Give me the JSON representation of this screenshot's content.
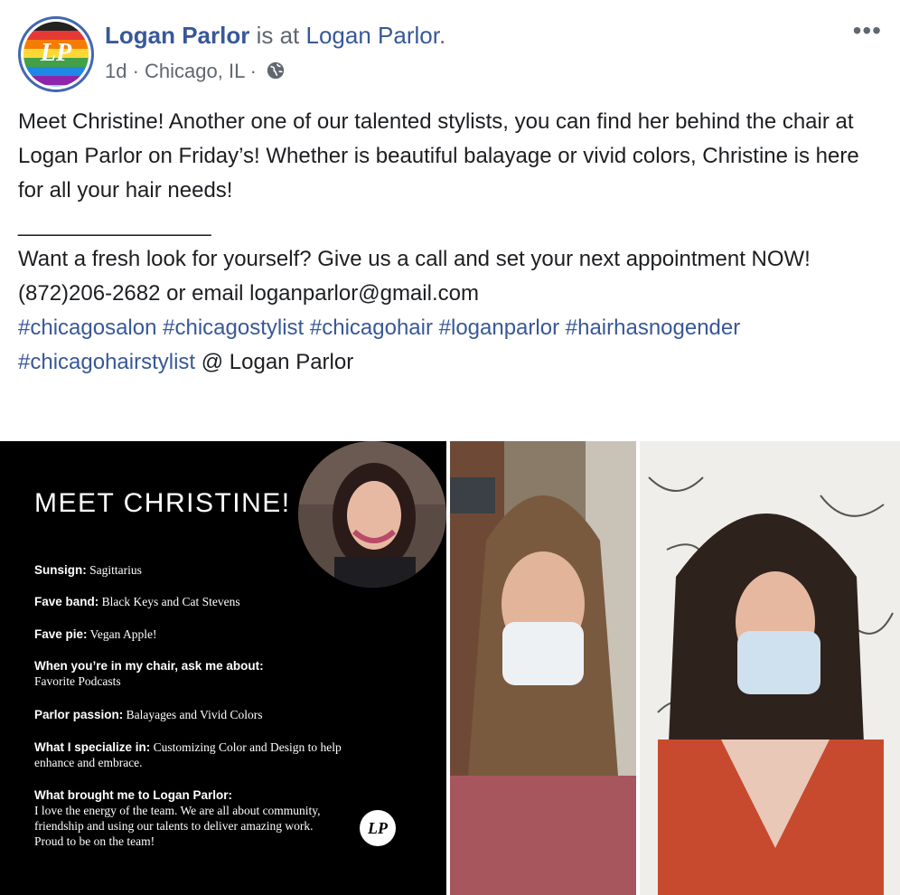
{
  "post": {
    "page_name": "Logan Parlor",
    "action_text": " is at ",
    "place_name": "Logan Parlor",
    "place_suffix": ".",
    "time": "1d",
    "location": "Chicago, IL",
    "separator": " · ",
    "more_label": "•••",
    "avatar_monogram": "LP",
    "avatar_stripe_colors": [
      "#222222",
      "#e53935",
      "#f57c00",
      "#fdd835",
      "#43a047",
      "#1e88e5",
      "#8e24aa",
      "#90caf9"
    ],
    "icons": {
      "audience": "globe-icon",
      "more": "more-options-icon"
    }
  },
  "body": {
    "paragraph1": "Meet Christine! Another one of our talented stylists, you can find her behind the chair at Logan Parlor on Friday’s! Whether is beautiful balayage or vivid colors, Christine is here for all your hair needs!",
    "divider": "________________",
    "paragraph2_line1": "Want a fresh look for yourself? Give us a call and set your next appointment NOW!",
    "paragraph2_line2": "(872)206-2682 or email loganparlor@gmail.com",
    "hashtags": [
      "#chicagosalon",
      "#chicagostylist",
      "#chicagohair",
      "#loganparlor",
      "#hairhasnogender",
      "#chicagohairstylist"
    ],
    "tag_suffix": " @ Logan Parlor"
  },
  "card": {
    "title": "MEET CHRISTINE!",
    "items": [
      {
        "key": "Sunsign:",
        "value": " Sagittarius"
      },
      {
        "key": "Fave band:",
        "value": " Black Keys and Cat Stevens"
      },
      {
        "key": "Fave pie:",
        "value": " Vegan Apple!"
      },
      {
        "key": "When you’re in my chair, ask me about:",
        "value": "Favorite Podcasts"
      },
      {
        "key": "Parlor passion:",
        "value": " Balayages and Vivid Colors"
      },
      {
        "key": "What I specialize in:",
        "value": " Customizing Color and Design to help enhance and embrace."
      },
      {
        "key": "What brought me to Logan Parlor:",
        "value": "I love the energy of the team. We are all about community, friendship and using our talents to deliver amazing work. Proud to be on the team!"
      }
    ],
    "badge": "LP"
  },
  "colors": {
    "link": "#385898",
    "text": "#1c1e21",
    "meta": "#606770",
    "card_bg": "#000000"
  }
}
